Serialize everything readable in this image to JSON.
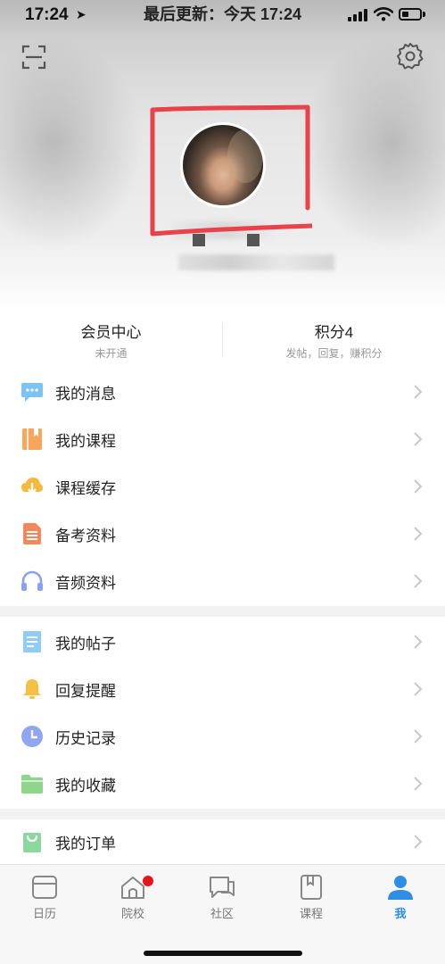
{
  "status_bar": {
    "time": "17:24",
    "update_text": "最后更新：今天 17:24"
  },
  "header": {
    "scan_icon": "scan-icon",
    "settings_icon": "gear-icon",
    "avatar_icon": "avatar-photo",
    "annotation_color": "#e8424b"
  },
  "stats": {
    "member": {
      "title": "会员中心",
      "subtitle": "未开通"
    },
    "points": {
      "title": "积分4",
      "subtitle": "发帖，回复，赚积分"
    }
  },
  "menu_groups": [
    {
      "items": [
        {
          "label": "我的消息",
          "icon": "message-icon",
          "color": "#7cc4f5"
        },
        {
          "label": "我的课程",
          "icon": "book-icon",
          "color": "#f7a65a"
        },
        {
          "label": "课程缓存",
          "icon": "cloud-download-icon",
          "color": "#f7b93d"
        },
        {
          "label": "备考资料",
          "icon": "document-icon",
          "color": "#f08a5d"
        },
        {
          "label": "音频资料",
          "icon": "headphones-icon",
          "color": "#8aa3f0"
        }
      ]
    },
    {
      "items": [
        {
          "label": "我的帖子",
          "icon": "post-icon",
          "color": "#8fcdf5"
        },
        {
          "label": "回复提醒",
          "icon": "bell-icon",
          "color": "#f7c043"
        },
        {
          "label": "历史记录",
          "icon": "clock-icon",
          "color": "#8fa6f2"
        },
        {
          "label": "我的收藏",
          "icon": "folder-icon",
          "color": "#8dd68a"
        }
      ]
    },
    {
      "items": [
        {
          "label": "我的订单",
          "icon": "shopping-bag-icon",
          "color": "#8dd69c"
        }
      ]
    }
  ],
  "tabbar": {
    "accent": "#2f8de4",
    "tabs": [
      {
        "label": "日历",
        "icon": "calendar-icon",
        "active": false
      },
      {
        "label": "院校",
        "icon": "school-icon",
        "active": false,
        "badge": true
      },
      {
        "label": "社区",
        "icon": "chat-icon",
        "active": false
      },
      {
        "label": "课程",
        "icon": "book-tab-icon",
        "active": false
      },
      {
        "label": "我",
        "icon": "user-icon",
        "active": true
      }
    ]
  }
}
